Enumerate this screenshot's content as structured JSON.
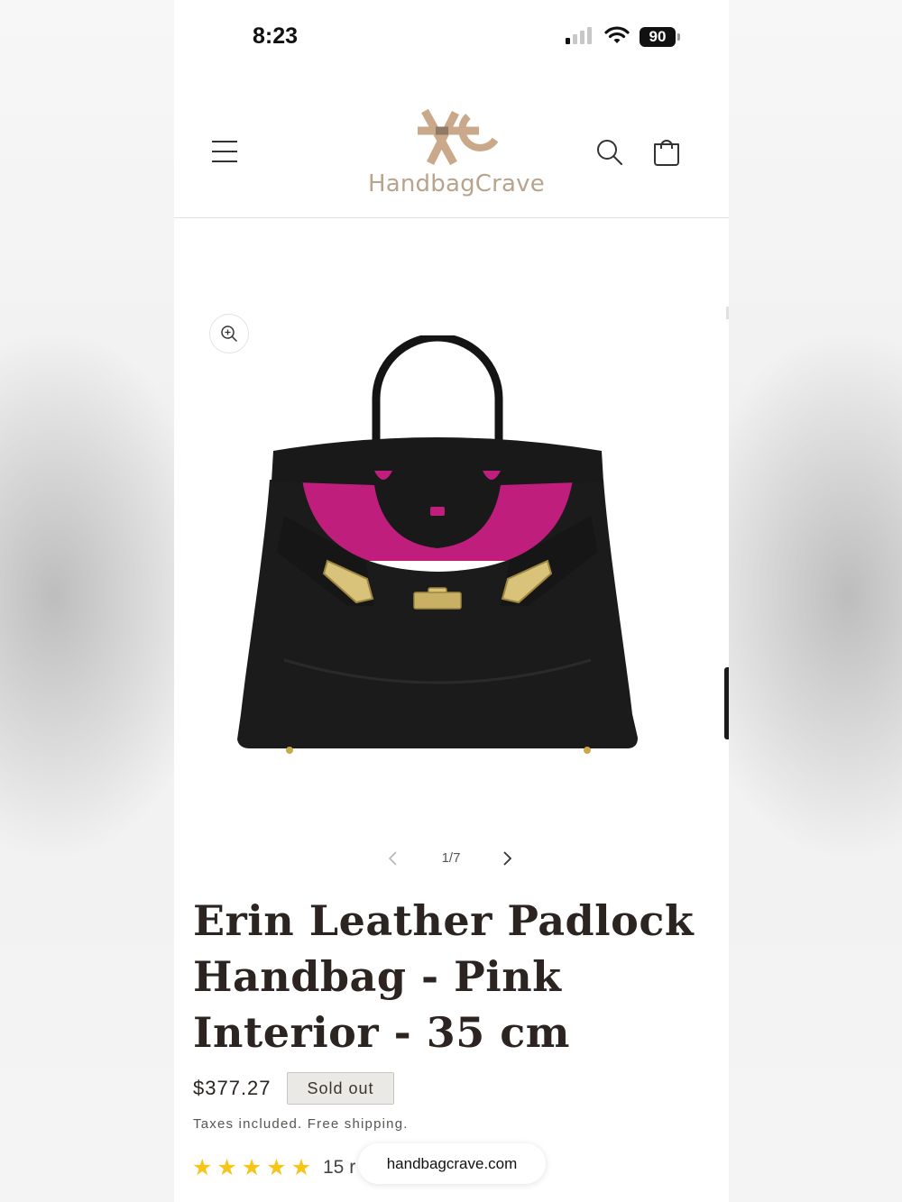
{
  "status_bar": {
    "time": "8:23",
    "battery": "90",
    "icons": [
      "signal-icon",
      "wifi-icon",
      "battery-icon"
    ]
  },
  "header": {
    "logo_text": "HandbagCrave",
    "icons": [
      "menu-icon",
      "search-icon",
      "cart-icon"
    ],
    "brand_color": "#b8a48c"
  },
  "gallery": {
    "counter": "1/7",
    "icons": [
      "zoom-in-icon",
      "chevron-left-icon",
      "chevron-right-icon"
    ]
  },
  "product": {
    "title": "Erin Leather Padlock Handbag - Pink Interior - 35 cm",
    "price": "$377.27",
    "badge": "Sold out",
    "tax_note": "Taxes included. Free shipping.",
    "rating_stars": 5,
    "review_count": "15 r",
    "star_color": "#f5c518"
  },
  "browser": {
    "url": "handbagcrave.com"
  }
}
